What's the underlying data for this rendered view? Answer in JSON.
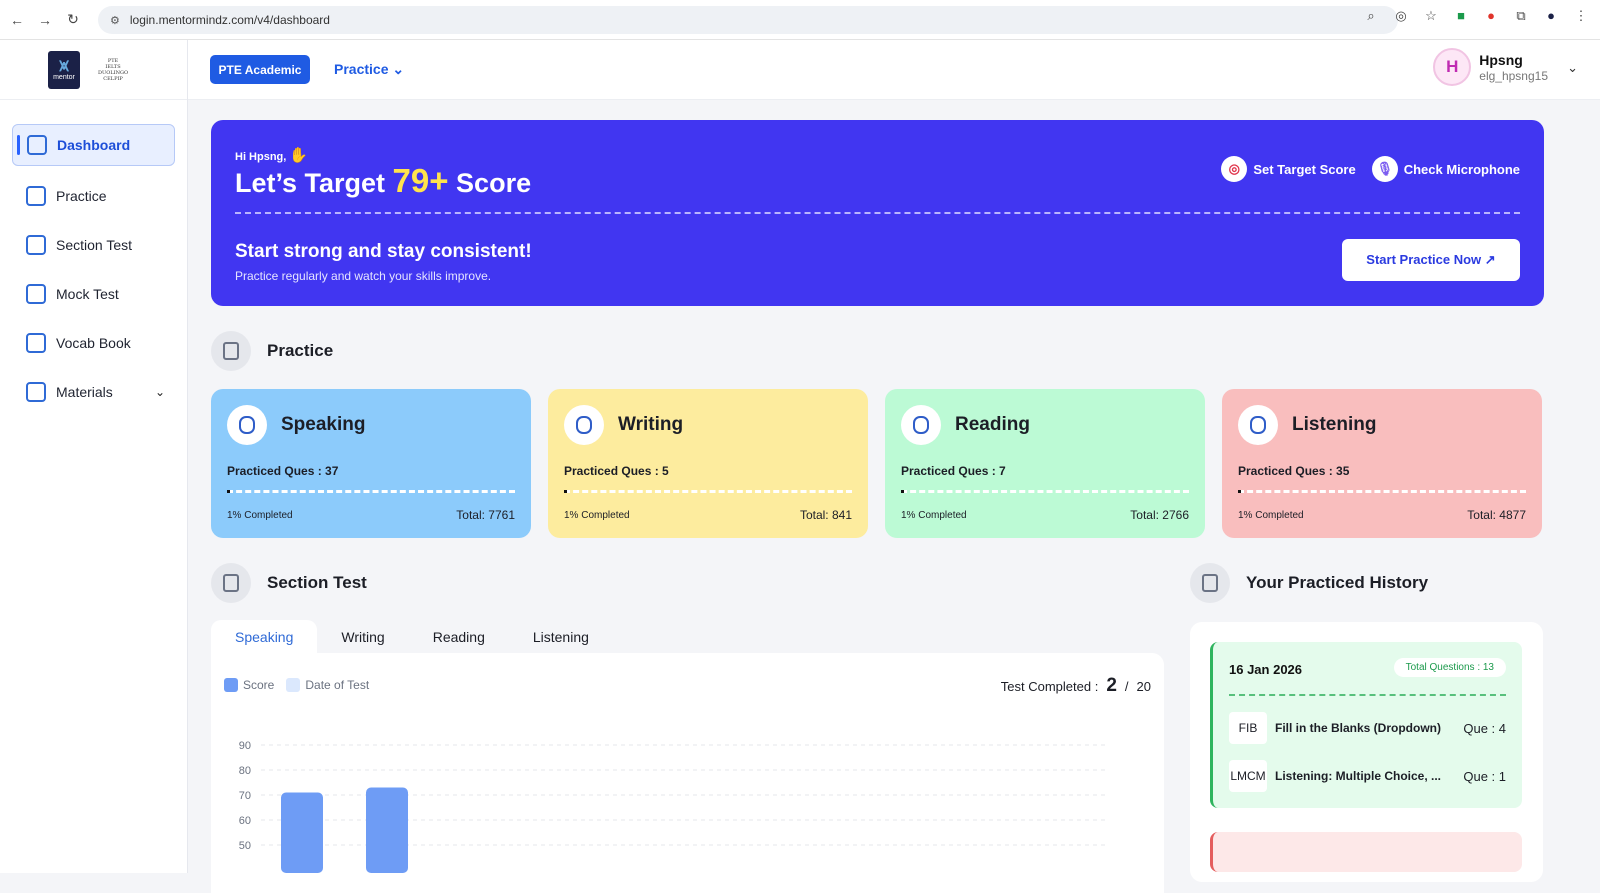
{
  "browser": {
    "url": "login.mentormindz.com/v4/dashboard"
  },
  "sidebar": {
    "logo_text": "mentor",
    "logo_sub": [
      "PTE",
      "IELTS",
      "DUOLINGO",
      "CELPIP"
    ],
    "items": [
      {
        "label": "Dashboard",
        "icon": "dashboard-icon"
      },
      {
        "label": "Practice",
        "icon": "clipboard-icon"
      },
      {
        "label": "Section Test",
        "icon": "section-icon"
      },
      {
        "label": "Mock Test",
        "icon": "clipboard-icon"
      },
      {
        "label": "Vocab Book",
        "icon": "book-icon"
      },
      {
        "label": "Materials",
        "icon": "materials-icon"
      }
    ]
  },
  "header": {
    "exam_button": "PTE Academic",
    "practice_menu": "Practice",
    "user": {
      "initial": "H",
      "name": "Hpsng",
      "id": "elg_hpsng15"
    }
  },
  "hero": {
    "greeting": "Hi Hpsng,",
    "title_pre": "Let’s Target",
    "target": "79+",
    "title_post": "Score",
    "set_target": "Set Target Score",
    "check_mic": "Check Microphone",
    "subtitle": "Start strong and stay consistent!",
    "subtitle2": "Practice regularly and watch your skills improve.",
    "cta": "Start Practice Now ↗"
  },
  "practice": {
    "heading": "Practice",
    "cards": [
      {
        "title": "Speaking",
        "practiced": "Practiced Ques : 37",
        "completed": "1% Completed",
        "total": "Total: 7761",
        "progress": 0.01,
        "color": "#8ccbfb"
      },
      {
        "title": "Writing",
        "practiced": "Practiced Ques : 5",
        "completed": "1% Completed",
        "total": "Total: 841",
        "progress": 0.01,
        "color": "#fdec9e"
      },
      {
        "title": "Reading",
        "practiced": "Practiced Ques : 7",
        "completed": "1% Completed",
        "total": "Total: 2766",
        "progress": 0.01,
        "color": "#bcfad5"
      },
      {
        "title": "Listening",
        "practiced": "Practiced Ques : 35",
        "completed": "1% Completed",
        "total": "Total: 4877",
        "progress": 0.01,
        "color": "#f9bebe"
      }
    ]
  },
  "section_test": {
    "heading": "Section Test",
    "tabs": [
      "Speaking",
      "Writing",
      "Reading",
      "Listening"
    ],
    "legend": [
      "Score",
      "Date of Test"
    ],
    "test_completed_label": "Test Completed :",
    "test_completed": "2",
    "test_total": "20"
  },
  "chart_data": {
    "type": "bar",
    "series": [
      {
        "name": "Score",
        "values": [
          71,
          73
        ]
      }
    ],
    "yticks": [
      50,
      60,
      70,
      80,
      90
    ],
    "ylim": [
      50,
      90
    ],
    "color": "#6e9cf5"
  },
  "history": {
    "heading": "Your Practiced History",
    "date": "16 Jan 2026",
    "badge": "Total Questions : 13",
    "rows": [
      {
        "code": "FIB",
        "name": "Fill in the Blanks (Dropdown)",
        "que": "Que : 4"
      },
      {
        "code": "LMCM",
        "name": "Listening: Multiple Choice, ...",
        "que": "Que : 1"
      }
    ]
  }
}
